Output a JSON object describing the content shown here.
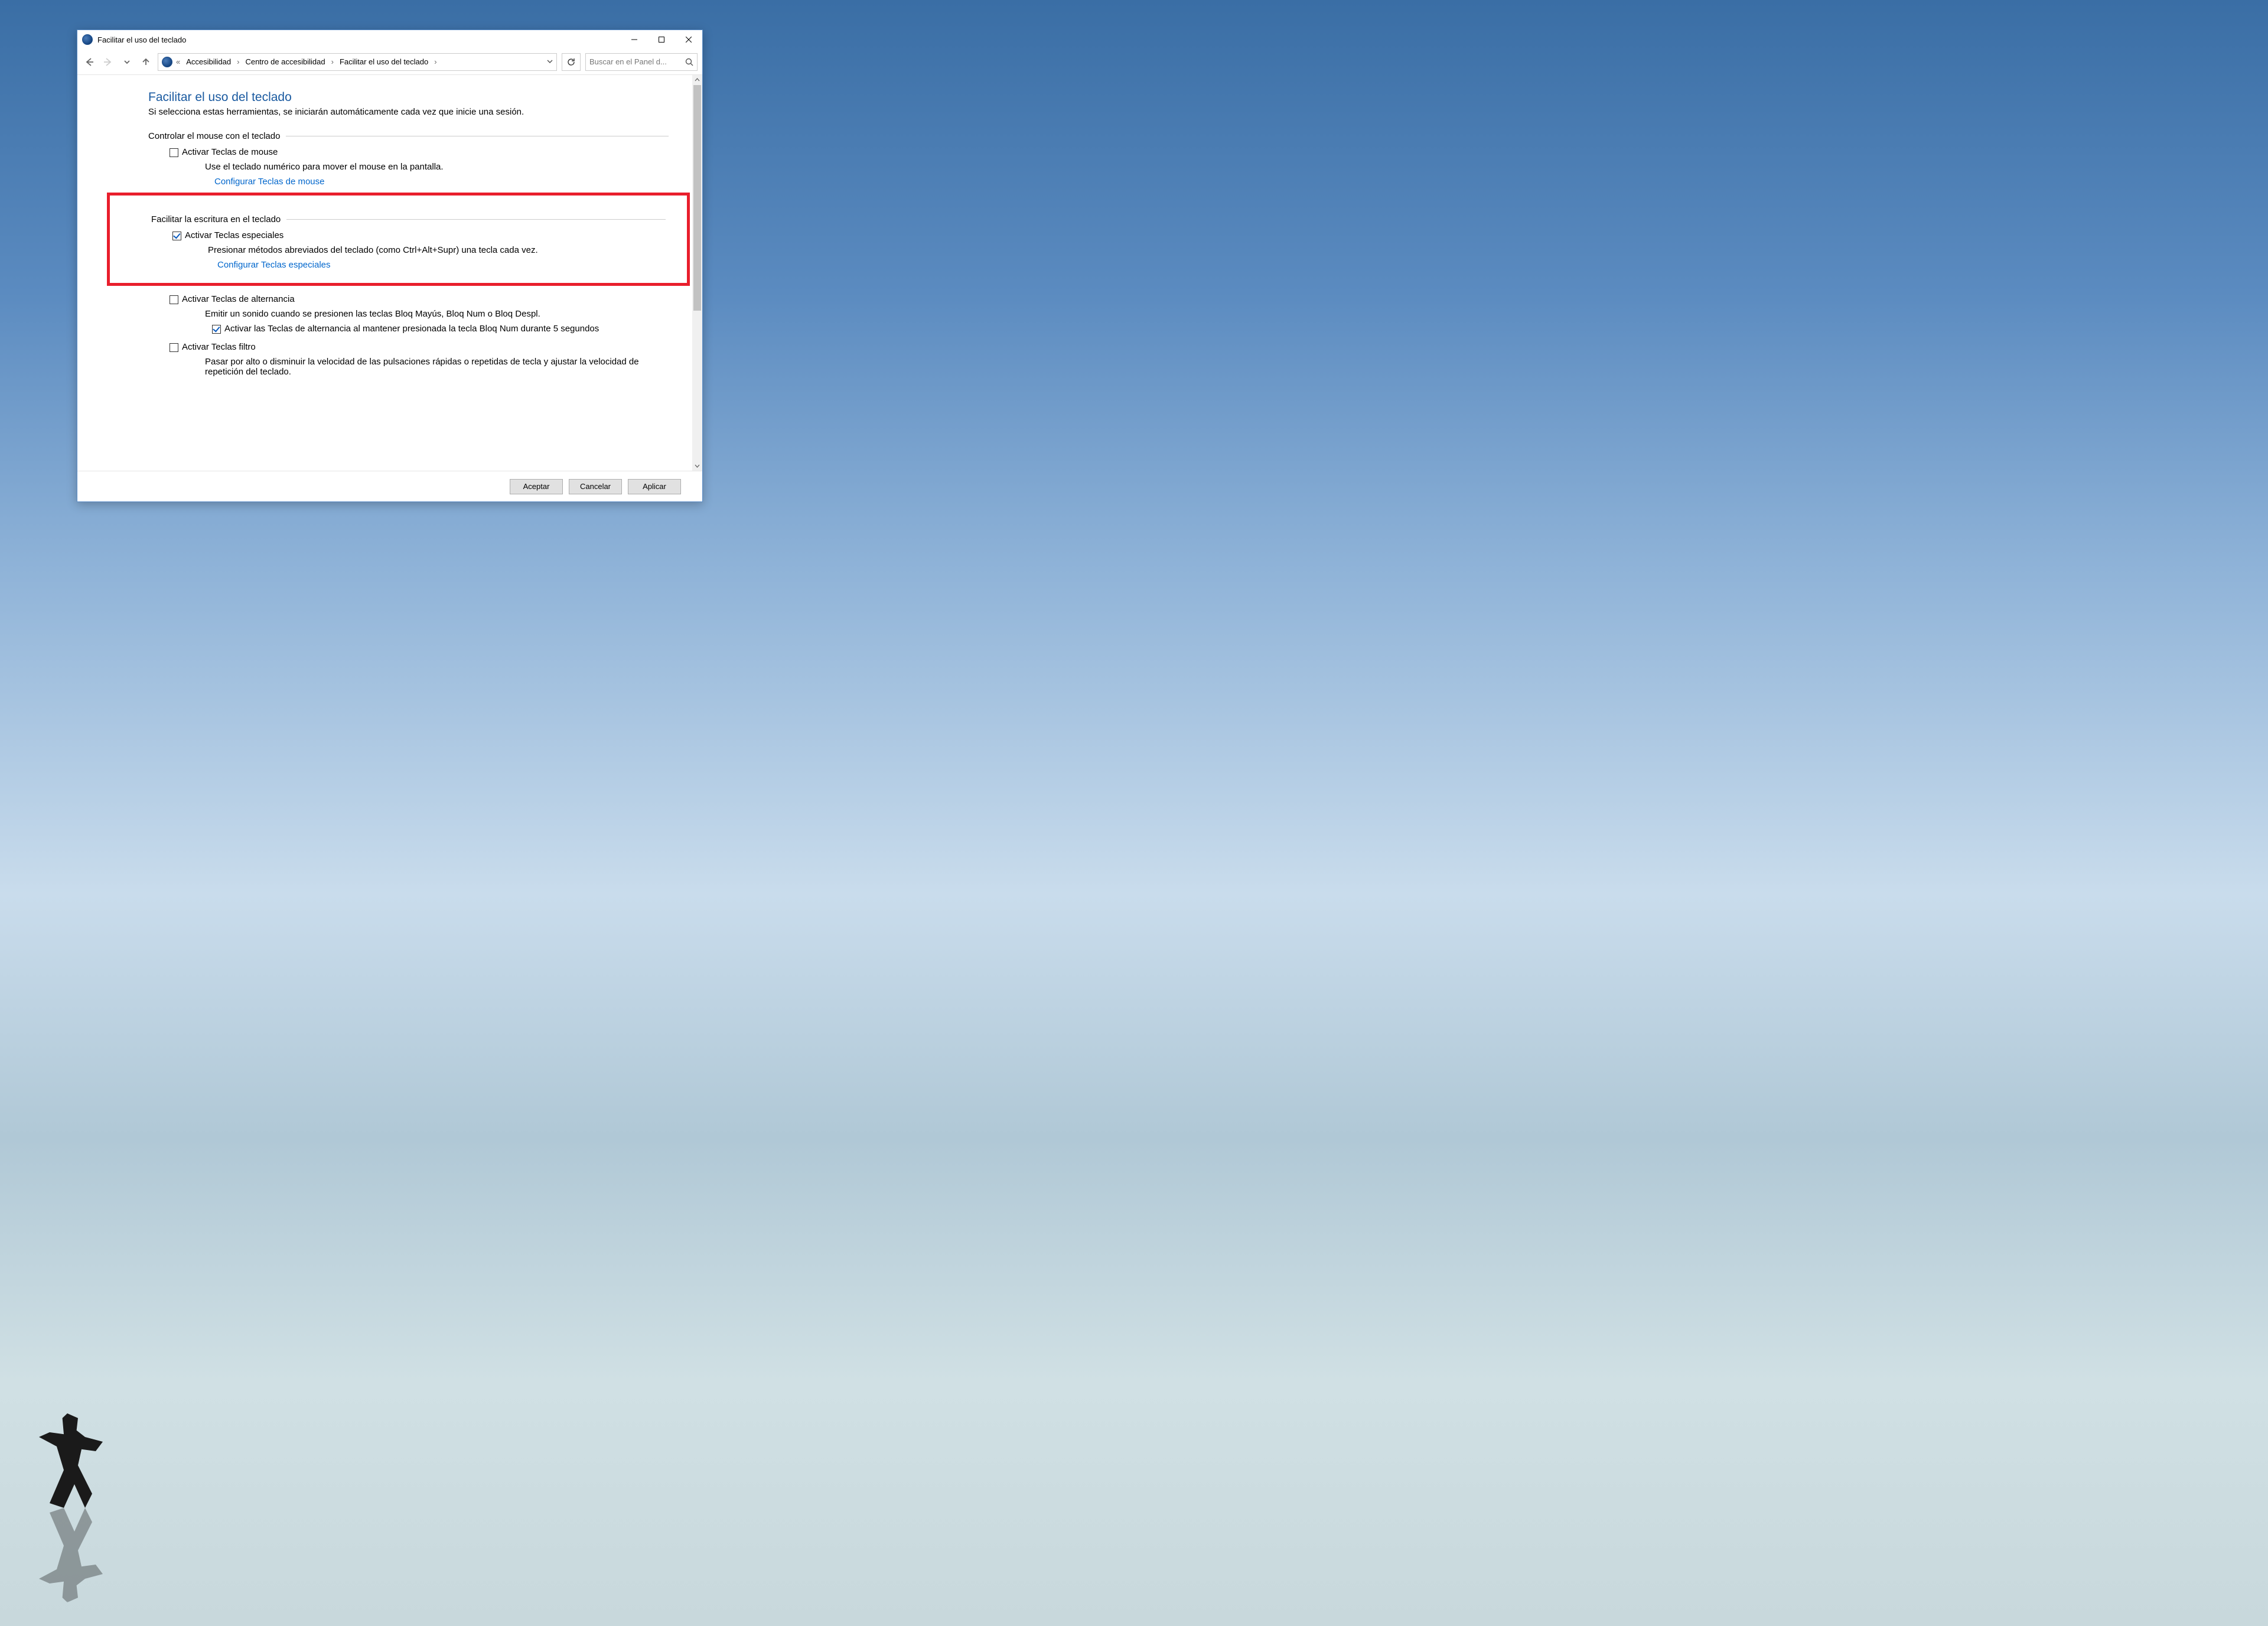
{
  "titlebar": {
    "caption": "Facilitar el uso del teclado"
  },
  "breadcrumb": {
    "overflow": "«",
    "c1": "Accesibilidad",
    "c2": "Centro de accesibilidad",
    "c3": "Facilitar el uso del teclado"
  },
  "search": {
    "placeholder": "Buscar en el Panel d..."
  },
  "page": {
    "title": "Facilitar el uso del teclado",
    "subtitle": "Si selecciona estas herramientas, se iniciarán automáticamente cada vez que inicie una sesión."
  },
  "group_mouse": {
    "legend": "Controlar el mouse con el teclado",
    "opt_label": "Activar Teclas de mouse",
    "opt_checked": false,
    "desc": "Use el teclado numérico para mover el mouse en la pantalla.",
    "link": "Configurar Teclas de mouse"
  },
  "group_type": {
    "legend": "Facilitar la escritura en el teclado",
    "sticky_label": "Activar Teclas especiales",
    "sticky_checked": true,
    "sticky_desc": "Presionar métodos abreviados del teclado (como Ctrl+Alt+Supr) una tecla cada vez.",
    "sticky_link": "Configurar Teclas especiales",
    "toggle_label": "Activar Teclas de alternancia",
    "toggle_checked": false,
    "toggle_desc": "Emitir un sonido cuando se presionen las teclas Bloq Mayús, Bloq Num o Bloq Despl.",
    "toggle_hold_label": "Activar las Teclas de alternancia al mantener presionada la tecla Bloq Num durante 5 segundos",
    "toggle_hold_checked": true,
    "filter_label": "Activar Teclas filtro",
    "filter_checked": false,
    "filter_desc": "Pasar por alto o disminuir la velocidad de las pulsaciones rápidas o repetidas de tecla y ajustar la velocidad de repetición del teclado."
  },
  "footer": {
    "ok": "Aceptar",
    "cancel": "Cancelar",
    "apply": "Aplicar"
  }
}
